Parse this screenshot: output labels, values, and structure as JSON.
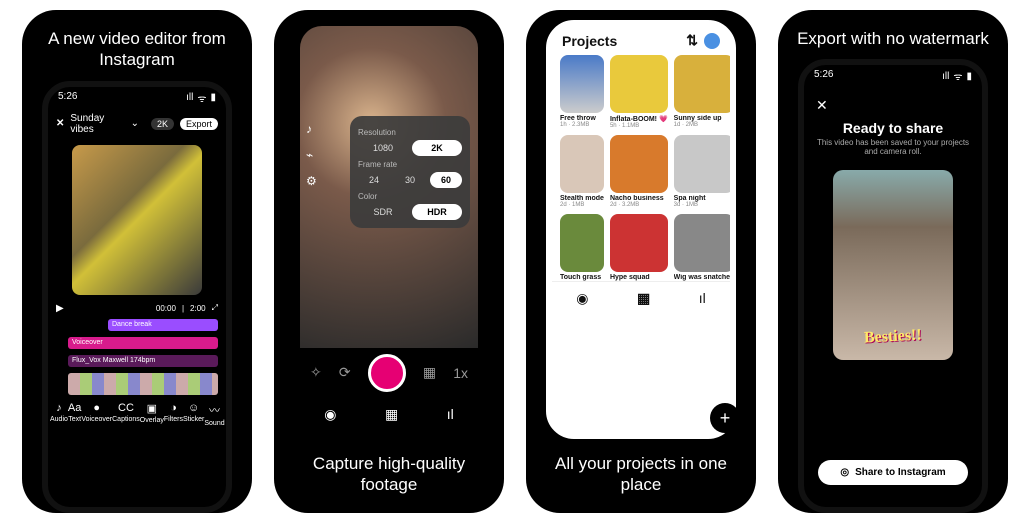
{
  "panels": [
    {
      "caption_top": "A new video editor from Instagram"
    },
    {
      "caption_bot": "Capture high-quality footage"
    },
    {
      "caption_bot": "All your projects in one place"
    },
    {
      "caption_top": "Export with no watermark"
    }
  ],
  "editor": {
    "time": "5:26",
    "project_name": "Sunday vibes",
    "quality_pill": "2K",
    "export_label": "Export",
    "scrub": {
      "current": "00:00",
      "total": "2:00"
    },
    "tracks": [
      {
        "label": "Dance break"
      },
      {
        "label": "Voiceover"
      },
      {
        "label": "Flux_Vox Maxwell  174bpm"
      }
    ],
    "toolbar": [
      {
        "icon": "♪",
        "label": "Audio"
      },
      {
        "icon": "Aa",
        "label": "Text"
      },
      {
        "icon": "●",
        "label": "Voiceover"
      },
      {
        "icon": "CC",
        "label": "Captions"
      },
      {
        "icon": "▣",
        "label": "Overlay"
      },
      {
        "icon": "◑",
        "label": "Filters"
      },
      {
        "icon": "☺",
        "label": "Sticker"
      },
      {
        "icon": "〰",
        "label": "Sound"
      }
    ]
  },
  "capture": {
    "side_icons": [
      "♪",
      "⌁",
      "⚙"
    ],
    "settings": {
      "resolution_label": "Resolution",
      "resolution": {
        "options": [
          "1080",
          "2K"
        ],
        "selected": "2K"
      },
      "framerate_label": "Frame rate",
      "framerate": {
        "options": [
          "24",
          "30",
          "60"
        ],
        "selected": "60"
      },
      "color_label": "Color",
      "color": {
        "options": [
          "SDR",
          "HDR"
        ],
        "selected": "HDR"
      }
    },
    "cam_icons": [
      "✧",
      "⟳",
      "▦",
      "1x"
    ],
    "nav_selected": 1
  },
  "projects": {
    "header": "Projects",
    "items": [
      {
        "title": "Free throw",
        "meta": "1h · 2.3MB",
        "cls": "c1"
      },
      {
        "title": "Inflata-BOOM! 💗",
        "meta": "5h · 1.1MB",
        "cls": "c2"
      },
      {
        "title": "Sunny side up",
        "meta": "1d · 2MB",
        "cls": "c3"
      },
      {
        "title": "Stealth mode",
        "meta": "2d · 1MB",
        "cls": "c4"
      },
      {
        "title": "Nacho business",
        "meta": "2d · 3.2MB",
        "cls": "c5"
      },
      {
        "title": "Spa night",
        "meta": "3d · 1MB",
        "cls": "c6"
      },
      {
        "title": "Touch grass",
        "meta": "",
        "cls": "c7"
      },
      {
        "title": "Hype squad",
        "meta": "",
        "cls": "c8"
      },
      {
        "title": "Wig was snatched",
        "meta": "",
        "cls": "c9"
      }
    ],
    "nav_selected": 1
  },
  "export": {
    "time": "5:26",
    "title": "Ready to share",
    "subtitle": "This video has been saved to your projects and camera roll.",
    "overlay_text": "Besties!!",
    "button": "Share to Instagram"
  },
  "nav_icons": [
    "◉",
    "▦",
    "ıl"
  ]
}
